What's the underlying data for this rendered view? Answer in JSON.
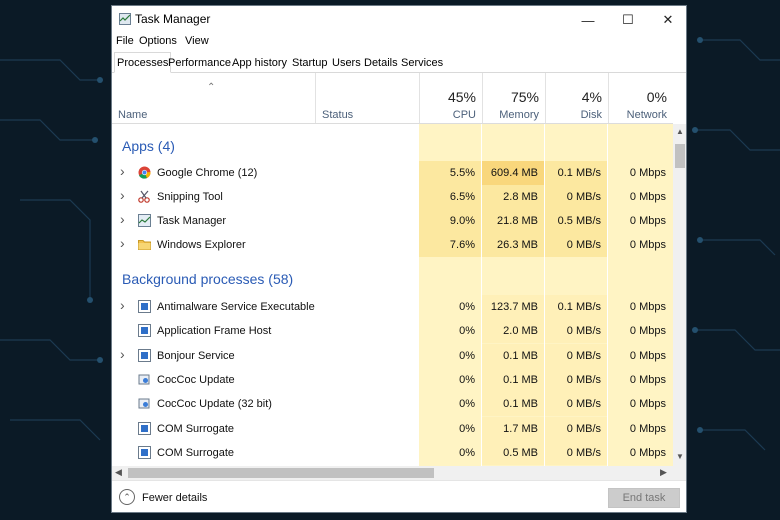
{
  "window": {
    "title": "Task Manager",
    "minimize_glyph": "—",
    "maximize_glyph": "☐",
    "close_glyph": "✕"
  },
  "menu": [
    "File",
    "Options",
    "View"
  ],
  "tabs": [
    "Processes",
    "Performance",
    "App history",
    "Startup",
    "Users",
    "Details",
    "Services"
  ],
  "active_tab": "Processes",
  "columns": {
    "name": "Name",
    "status": "Status",
    "cpu": {
      "percent": "45%",
      "label": "CPU"
    },
    "memory": {
      "percent": "75%",
      "label": "Memory"
    },
    "disk": {
      "percent": "4%",
      "label": "Disk"
    },
    "network": {
      "percent": "0%",
      "label": "Network"
    }
  },
  "groups": {
    "apps": {
      "label": "Apps (4)",
      "rows": [
        {
          "name": "Google Chrome (12)",
          "cpu": "5.5%",
          "memory": "609.4 MB",
          "disk": "0.1 MB/s",
          "network": "0 Mbps",
          "icon": "chrome-icon",
          "expand": true
        },
        {
          "name": "Snipping Tool",
          "cpu": "6.5%",
          "memory": "2.8 MB",
          "disk": "0 MB/s",
          "network": "0 Mbps",
          "icon": "scissors-icon",
          "expand": true
        },
        {
          "name": "Task Manager",
          "cpu": "9.0%",
          "memory": "21.8 MB",
          "disk": "0.5 MB/s",
          "network": "0 Mbps",
          "icon": "task-manager-icon",
          "expand": true
        },
        {
          "name": "Windows Explorer",
          "cpu": "7.6%",
          "memory": "26.3 MB",
          "disk": "0 MB/s",
          "network": "0 Mbps",
          "icon": "folder-icon",
          "expand": true
        }
      ]
    },
    "background": {
      "label": "Background processes (58)",
      "rows": [
        {
          "name": "Antimalware Service Executable",
          "cpu": "0%",
          "memory": "123.7 MB",
          "disk": "0.1 MB/s",
          "network": "0 Mbps",
          "icon": "service-icon",
          "expand": true
        },
        {
          "name": "Application Frame Host",
          "cpu": "0%",
          "memory": "2.0 MB",
          "disk": "0 MB/s",
          "network": "0 Mbps",
          "icon": "service-icon",
          "expand": false
        },
        {
          "name": "Bonjour Service",
          "cpu": "0%",
          "memory": "0.1 MB",
          "disk": "0 MB/s",
          "network": "0 Mbps",
          "icon": "service-icon",
          "expand": true
        },
        {
          "name": "CocCoc Update",
          "cpu": "0%",
          "memory": "0.1 MB",
          "disk": "0 MB/s",
          "network": "0 Mbps",
          "icon": "updater-icon",
          "expand": false
        },
        {
          "name": "CocCoc Update (32 bit)",
          "cpu": "0%",
          "memory": "0.1 MB",
          "disk": "0 MB/s",
          "network": "0 Mbps",
          "icon": "updater-icon",
          "expand": false
        },
        {
          "name": "COM Surrogate",
          "cpu": "0%",
          "memory": "1.7 MB",
          "disk": "0 MB/s",
          "network": "0 Mbps",
          "icon": "service-icon",
          "expand": false
        },
        {
          "name": "COM Surrogate",
          "cpu": "0%",
          "memory": "0.5 MB",
          "disk": "0 MB/s",
          "network": "0 Mbps",
          "icon": "service-icon",
          "expand": false
        }
      ]
    }
  },
  "footer": {
    "fewer_details": "Fewer details",
    "end_task": "End task"
  },
  "colors": {
    "heat_light": "#fff4c4",
    "heat_mid": "#fce8a0",
    "heat_high": "#f9d77c",
    "group_text": "#2a5bb5"
  }
}
